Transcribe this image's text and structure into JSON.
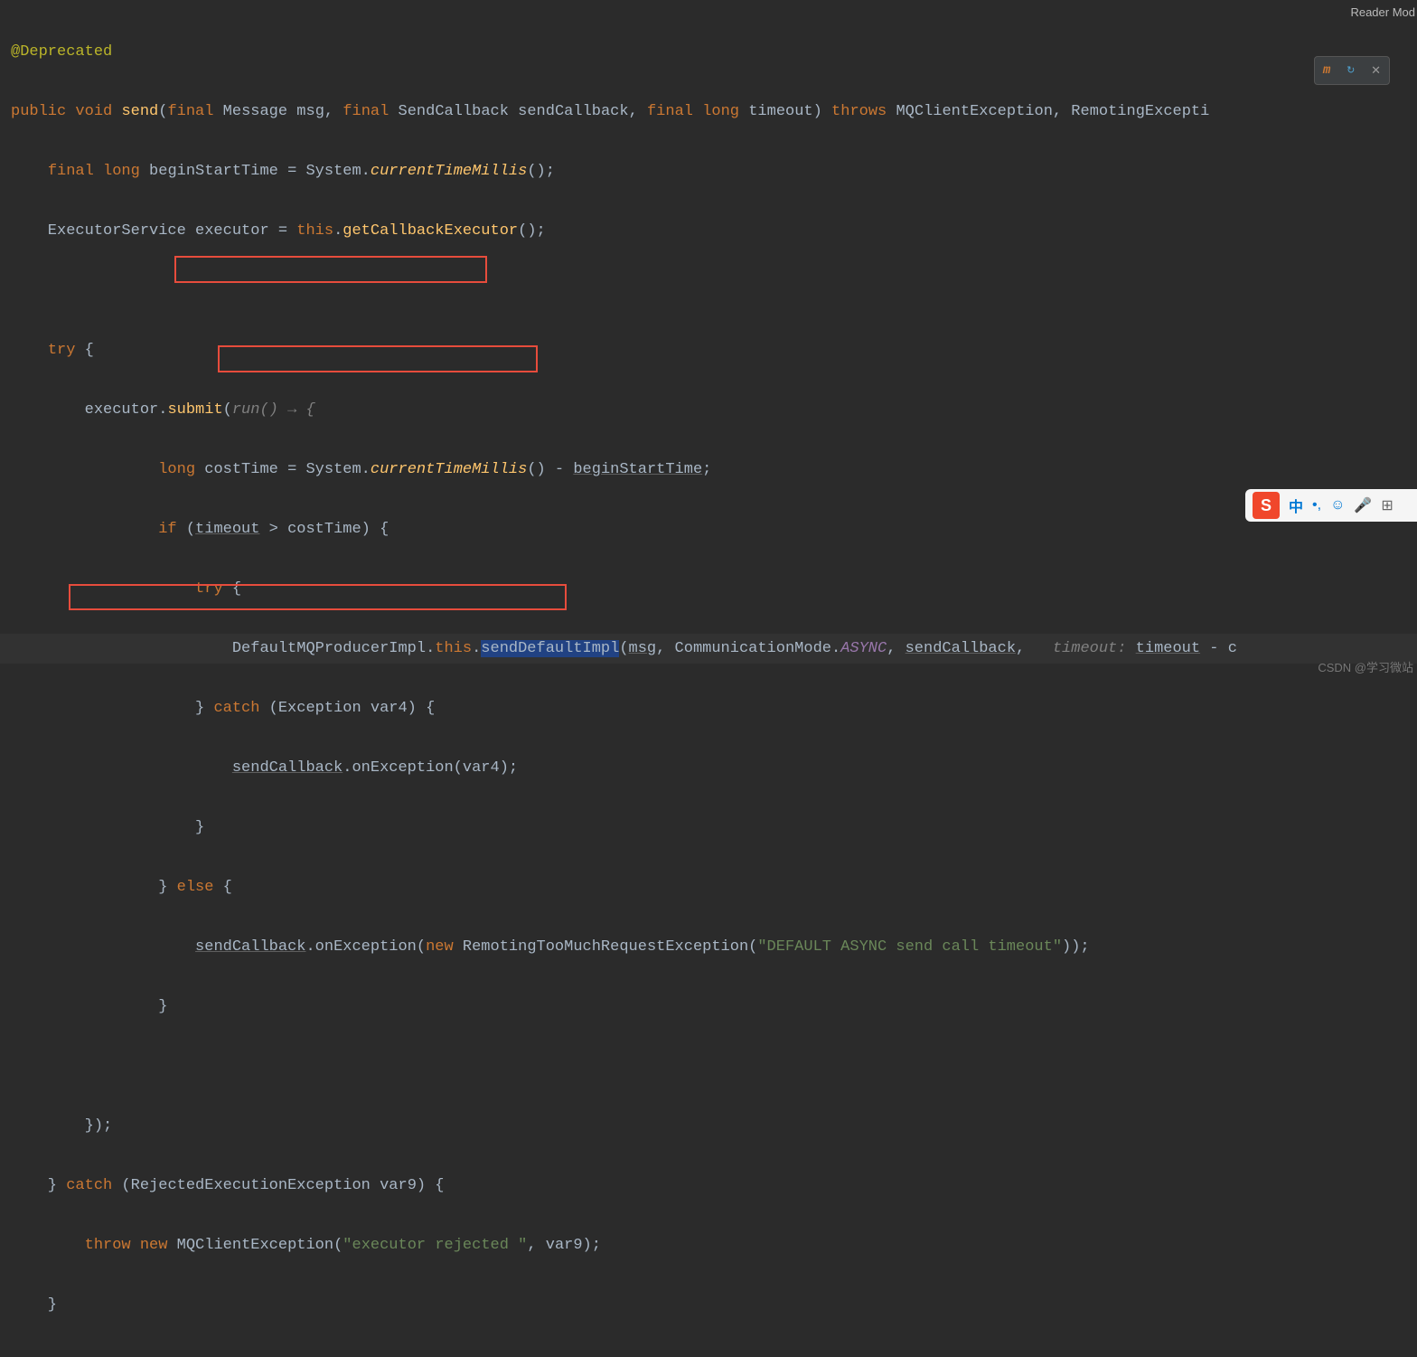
{
  "reader_mode": "Reader Mod",
  "watermark": "CSDN @学习微站",
  "code": {
    "annotation": "@Deprecated",
    "sig": {
      "public": "public",
      "void": "void",
      "send": "send",
      "open": "(",
      "final1": "final",
      "Message": "Message",
      "msg": "msg",
      "c1": ", ",
      "final2": "final",
      "SendCallback": "SendCallback",
      "sendCallback": "sendCallback",
      "c2": ", ",
      "final3": "final",
      "long": "long",
      "timeout": "timeout",
      "close": ") ",
      "throws": "throws",
      "exc": " MQClientException, RemotingExcepti"
    },
    "l3": {
      "indent": "    ",
      "final": "final",
      "sp": " ",
      "long": "long",
      "var": " beginStartTime = System.",
      "call": "currentTimeMillis",
      "tail": "();"
    },
    "l4": {
      "indent": "    ExecutorService executor = ",
      "this": "this",
      "dot": ".",
      "call": "getCallbackExecutor",
      "tail": "();"
    },
    "l6": {
      "indent": "    ",
      "try": "try",
      "brace": " {"
    },
    "l7": {
      "indent": "        executor.",
      "submit": "submit",
      "open": "(",
      "run": "run() → {"
    },
    "l8": {
      "indent": "                ",
      "long": "long",
      "var": " costTime = System.",
      "call": "currentTimeMillis",
      "mid": "() - ",
      "begin": "beginStartTime",
      "tail": ";"
    },
    "l9": {
      "indent": "                ",
      "if": "if",
      "sp": " (",
      "timeout": "timeout",
      "cmp": " > costTime) {"
    },
    "l10": {
      "indent": "                    ",
      "try": "try",
      "brace": " {"
    },
    "l11": {
      "indent": "                        DefaultMQProducerImpl.",
      "this": "this",
      "dot": ".",
      "sendDef": "sendDefaultImpl",
      "open": "(",
      "msg": "msg",
      "c1": ", CommunicationMode.",
      "async": "ASYNC",
      "c2": ", ",
      "sendCb": "sendCallback",
      "c3": ",   ",
      "hint": "timeout:",
      "sp": " ",
      "timeout": "timeout",
      "tail": " - c"
    },
    "l12": {
      "indent": "                    } ",
      "catch": "catch",
      "mid": " (Exception var4) {"
    },
    "l13": {
      "indent": "                        ",
      "sendCb": "sendCallback",
      "tail": ".onException(var4);"
    },
    "l14": "                    }",
    "l15": {
      "indent": "                } ",
      "else": "else",
      "brace": " {"
    },
    "l16": {
      "indent": "                    ",
      "sendCb": "sendCallback",
      "mid": ".onException(",
      "new": "new",
      "sp": " RemotingTooMuchRequestException(",
      "str": "\"DEFAULT ASYNC send call timeout\"",
      "tail": "));"
    },
    "l17": "                }",
    "l19": "        });",
    "l20": {
      "indent": "    } ",
      "catch": "catch",
      "mid": " (RejectedExecutionException var9) {"
    },
    "l21": {
      "indent": "        ",
      "throw": "throw",
      "sp": " ",
      "new": "new",
      "mid": " MQClientException(",
      "str": "\"executor rejected \"",
      "tail": ", var9);"
    },
    "l22": "    }"
  },
  "ime": {
    "s": "S",
    "ch": "中"
  }
}
